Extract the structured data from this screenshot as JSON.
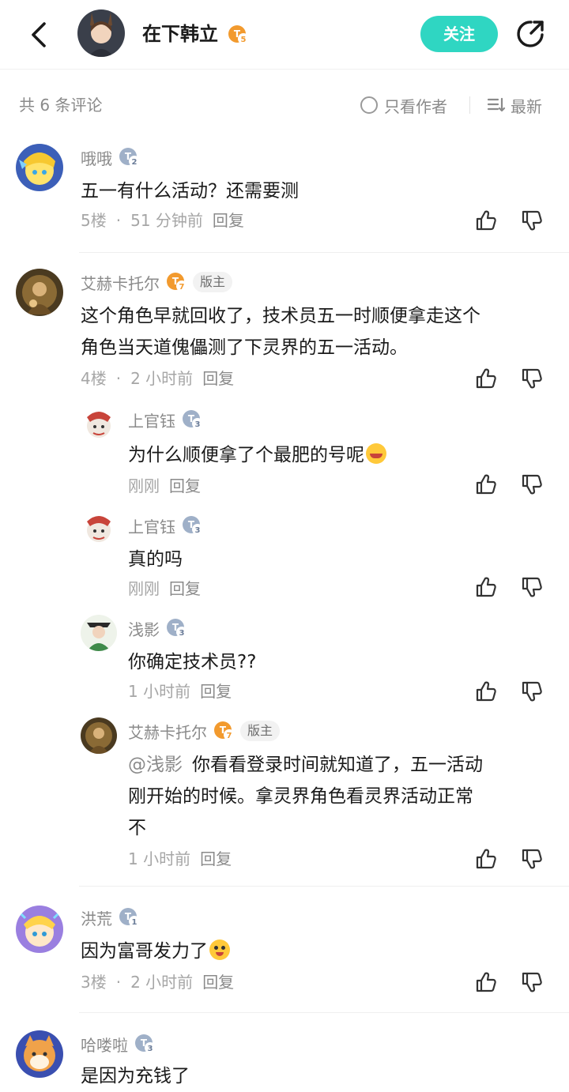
{
  "header": {
    "title": "在下韩立",
    "level": "5",
    "follow_label": "关注"
  },
  "filter": {
    "count_label": "共 6 条评论",
    "only_author_label": "只看作者",
    "sort_label": "最新"
  },
  "comments": [
    {
      "name": "哦哦",
      "level": "2",
      "text": "五一有什么活动？还需要测",
      "floor": "5楼",
      "time": "51 分钟前",
      "reply": "回复"
    },
    {
      "name": "艾赫卡托尔",
      "level": "7",
      "mod": "版主",
      "text1": "这个角色早就回收了，技术员五一时顺便拿走这个",
      "text2": "角色当天道傀儡测了下灵界的五一活动。",
      "floor": "4楼",
      "time": "2 小时前",
      "reply": "回复"
    },
    {
      "name": "洪荒",
      "level": "1",
      "text": "因为富哥发力了",
      "floor": "3楼",
      "time": "2 小时前",
      "reply": "回复"
    },
    {
      "name": "哈喽啦",
      "level": "3",
      "text": "是因为充钱了"
    }
  ],
  "replies": [
    {
      "name": "上官钰",
      "level": "3",
      "text": "为什么顺便拿了个最肥的号呢",
      "time": "刚刚",
      "reply": "回复"
    },
    {
      "name": "上官钰",
      "level": "3",
      "text": "真的吗",
      "time": "刚刚",
      "reply": "回复"
    },
    {
      "name": "浅影",
      "level": "3",
      "text": "你确定技术员??",
      "time": "1 小时前",
      "reply": "回复"
    },
    {
      "name": "艾赫卡托尔",
      "level": "7",
      "mod": "版主",
      "mention": "@浅影",
      "text1": "你看看登录时间就知道了，五一活动",
      "text2": "刚开始的时候。拿灵界角色看灵界活动正常",
      "text3": "不",
      "time": "1 小时前",
      "reply": "回复"
    }
  ],
  "colors": {
    "accent": "#2fd6c2",
    "level_gray": "#9fb0c8",
    "level_orange": "#f29a2e"
  },
  "icons": [
    "back-arrow-icon",
    "share-icon",
    "radio-icon",
    "sort-icon",
    "thumbs-up-icon",
    "thumbs-down-icon",
    "level-badge-icon"
  ]
}
